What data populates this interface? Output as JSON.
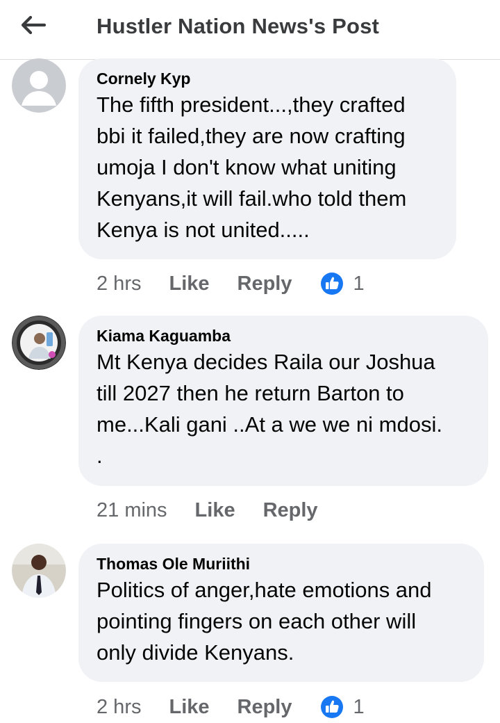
{
  "header": {
    "title": "Hustler Nation News's Post"
  },
  "comments": [
    {
      "author": "Cornely Kyp",
      "text": "The fifth president...,they crafted\nbbi it failed,they are now crafting\numoja I don't know what uniting\nKenyans,it will fail.who told them\nKenya is not united.....",
      "time": "2 hrs",
      "like_label": "Like",
      "reply_label": "Reply",
      "reaction_count": "1"
    },
    {
      "author": "Kiama Kaguamba",
      "text": "Mt Kenya decides Raila our Joshua\ntill 2027 then he return Barton to\nme...Kali gani ..At a we we ni mdosi.\n.",
      "time": "21 mins",
      "like_label": "Like",
      "reply_label": "Reply"
    },
    {
      "author": "Thomas Ole Muriithi",
      "text": "Politics of anger,hate emotions and\npointing fingers on each other will\nonly divide Kenyans.",
      "time": "2 hrs",
      "like_label": "Like",
      "reply_label": "Reply",
      "reaction_count": "1"
    }
  ],
  "icons": {
    "back": "arrow-left-icon",
    "reaction": "thumbs-up-icon"
  },
  "colors": {
    "bubble": "#f0f2f5",
    "like_blue": "#1877f2",
    "muted_text": "#65676b"
  }
}
